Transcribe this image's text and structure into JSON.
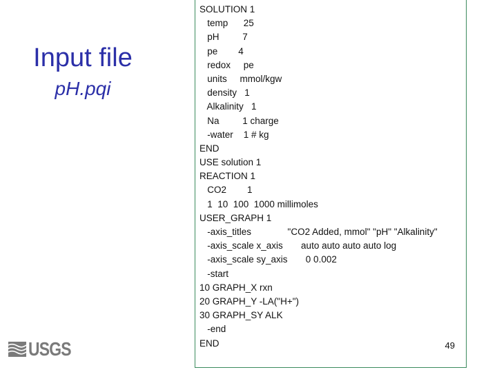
{
  "slide": {
    "title": "Input file",
    "subtitle": "pH.pqi",
    "page_number": "49",
    "logo_text": "USGS",
    "colors": {
      "title": "#2b2fa8",
      "box_border": "#3a8a5c",
      "logo": "#7a7a7a"
    }
  },
  "code": {
    "lines": [
      "SOLUTION 1",
      "   temp      25",
      "   pH         7",
      "   pe        4",
      "   redox     pe",
      "   units     mmol/kgw",
      "   density   1",
      "   Alkalinity   1",
      "   Na         1 charge",
      "   -water    1 # kg",
      "END",
      "USE solution 1",
      "REACTION 1",
      "   CO2        1",
      "   1  10  100  1000 millimoles",
      "USER_GRAPH 1",
      "   -axis_titles              \"CO2 Added, mmol\" \"pH\" \"Alkalinity\"",
      "   -axis_scale x_axis       auto auto auto auto log",
      "   -axis_scale sy_axis       0 0.002",
      "   -start",
      "10 GRAPH_X rxn",
      "20 GRAPH_Y -LA(\"H+\")",
      "30 GRAPH_SY ALK",
      "   -end",
      "END"
    ]
  }
}
